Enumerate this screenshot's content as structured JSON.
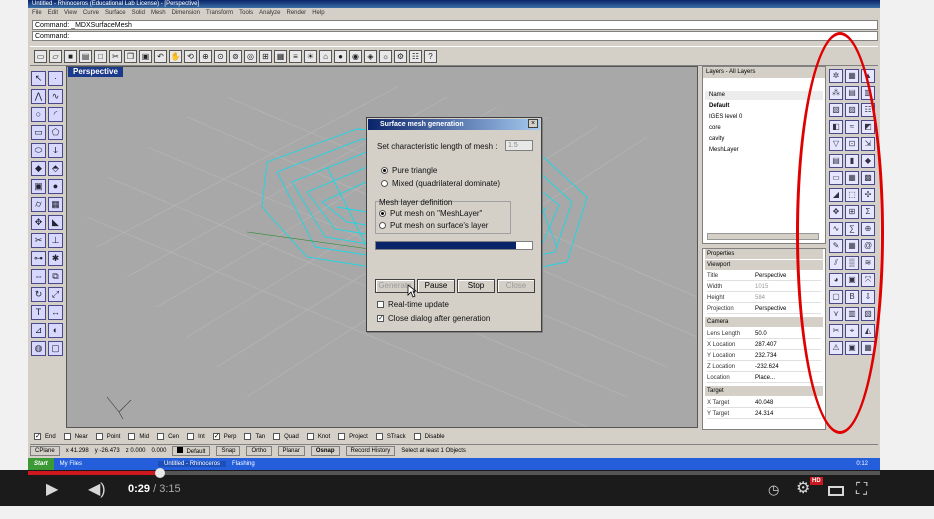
{
  "window": {
    "title": "Untitled - Rhinoceros (Educational Lab License) - [Perspective]"
  },
  "menu": [
    "File",
    "Edit",
    "View",
    "Curve",
    "Surface",
    "Solid",
    "Mesh",
    "Dimension",
    "Transform",
    "Tools",
    "Analyze",
    "Render",
    "Help"
  ],
  "command": {
    "history": "Command: _MDXSurfaceMesh",
    "prompt": "Command:"
  },
  "viewport": {
    "label": "Perspective"
  },
  "dialog": {
    "title": "Surface mesh generation",
    "length_label": "Set characteristic length of mesh :",
    "length_value": "1.5",
    "opt_pure": "Pure triangle",
    "opt_mixed": "Mixed (quadrilateral dominate)",
    "group_label": "Mesh layer definition",
    "opt_meshlayer": "Put mesh on \"MeshLayer\"",
    "opt_surface": "Put mesh on surface's layer",
    "progress": 0.9,
    "btn_generate": "Generate",
    "btn_pause": "Pause",
    "btn_stop": "Stop",
    "btn_close": "Close",
    "chk_realtime": "Real-time update",
    "chk_close": "Close dialog after generation"
  },
  "layers": {
    "header": "Layers - All Layers",
    "col_name": "Name",
    "rows": [
      "Default",
      "IGES level 0",
      "core",
      "cavity",
      "MeshLayer"
    ]
  },
  "properties": {
    "header": "Properties",
    "sec_viewport": "Viewport",
    "rows1": [
      {
        "label": "Title",
        "value": "Perspective"
      },
      {
        "label": "Width",
        "value": "1015"
      },
      {
        "label": "Height",
        "value": "584"
      },
      {
        "label": "Projection",
        "value": "Perspective"
      }
    ],
    "sec_camera": "Camera",
    "rows2": [
      {
        "label": "Lens Length",
        "value": "50.0"
      },
      {
        "label": "X Location",
        "value": "287.407"
      },
      {
        "label": "Y Location",
        "value": "232.734"
      },
      {
        "label": "Z Location",
        "value": "-232.624"
      },
      {
        "label": "Location",
        "value": "Place..."
      }
    ],
    "sec_target": "Target",
    "rows3": [
      {
        "label": "X Target",
        "value": "40.048"
      },
      {
        "label": "Y Target",
        "value": "24.314"
      }
    ]
  },
  "osnap": [
    "End",
    "Near",
    "Point",
    "Mid",
    "Cen",
    "Int",
    "Perp",
    "Tan",
    "Quad",
    "Knot",
    "Project",
    "STrack",
    "Disable"
  ],
  "status": {
    "cplane": "CPlane",
    "x": "x 41.298",
    "y": "y -26.473",
    "z": "z 0.000",
    "d": "0.000",
    "layer": "Default",
    "snap": "Snap",
    "ortho": "Ortho",
    "planar": "Planar",
    "osnap": "Osnap",
    "history": "Record History",
    "message": "Select at least 1 Objects"
  },
  "taskbar": {
    "start": "Start",
    "myfiles": "My Files",
    "rhino": "Untitled - Rhinoceros",
    "flashing": "Flashing",
    "clock": "0:12"
  },
  "video": {
    "current": "0:29",
    "separator": " / ",
    "duration": "3:15",
    "progress": 0.155,
    "hd": "HD"
  }
}
